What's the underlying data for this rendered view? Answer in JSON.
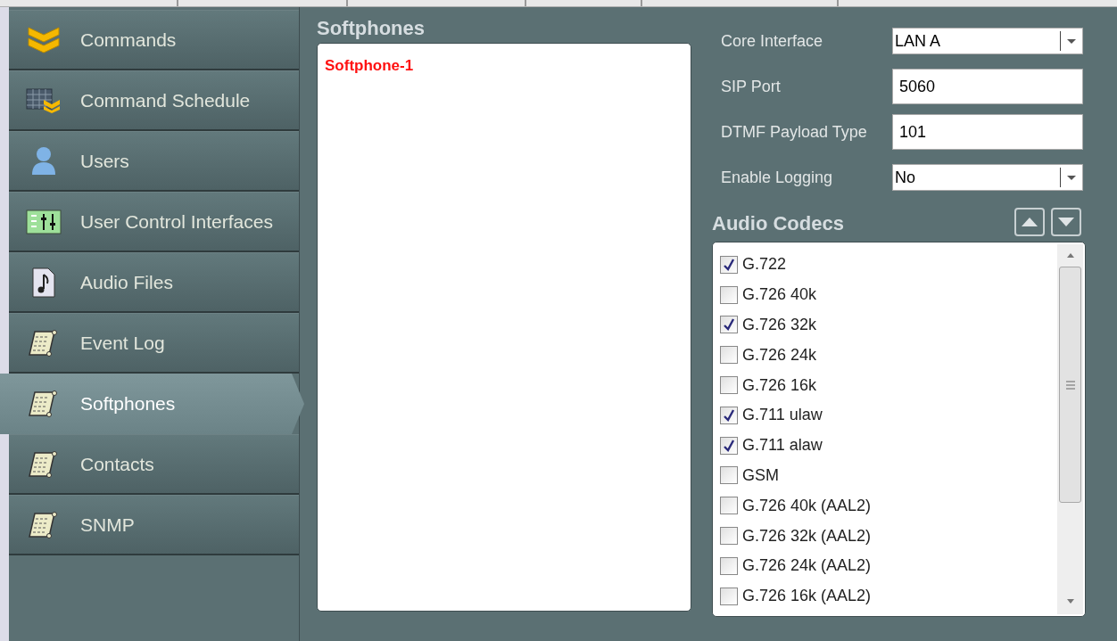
{
  "sidebar": {
    "items": [
      {
        "label": "Commands",
        "kind": "chevrons",
        "selected": false
      },
      {
        "label": "Command Schedule",
        "kind": "schedule",
        "selected": false
      },
      {
        "label": "Users",
        "kind": "user",
        "selected": false
      },
      {
        "label": "User Control Interfaces",
        "kind": "controls",
        "selected": false
      },
      {
        "label": "Audio Files",
        "kind": "audio",
        "selected": false
      },
      {
        "label": "Event Log",
        "kind": "scroll",
        "selected": false
      },
      {
        "label": "Softphones",
        "kind": "scroll",
        "selected": true
      },
      {
        "label": "Contacts",
        "kind": "scroll",
        "selected": false
      },
      {
        "label": "SNMP",
        "kind": "scroll",
        "selected": false
      }
    ]
  },
  "softphones": {
    "title": "Softphones",
    "items": [
      "Softphone-1"
    ]
  },
  "settings": [
    {
      "label": "Core Interface",
      "kind": "dropdown",
      "value": "LAN A"
    },
    {
      "label": "SIP Port",
      "kind": "text",
      "value": "5060"
    },
    {
      "label": "DTMF Payload Type",
      "kind": "text",
      "value": "101"
    },
    {
      "label": "Enable Logging",
      "kind": "dropdown",
      "value": "No"
    }
  ],
  "audio_codecs": {
    "title": "Audio Codecs",
    "items": [
      {
        "label": "G.722",
        "checked": true
      },
      {
        "label": "G.726 40k",
        "checked": false
      },
      {
        "label": "G.726 32k",
        "checked": true
      },
      {
        "label": "G.726 24k",
        "checked": false
      },
      {
        "label": "G.726 16k",
        "checked": false
      },
      {
        "label": "G.711 ulaw",
        "checked": true
      },
      {
        "label": "G.711 alaw",
        "checked": true
      },
      {
        "label": "GSM",
        "checked": false
      },
      {
        "label": "G.726 40k (AAL2)",
        "checked": false
      },
      {
        "label": "G.726 32k (AAL2)",
        "checked": false
      },
      {
        "label": "G.726 24k (AAL2)",
        "checked": false
      },
      {
        "label": "G.726 16k (AAL2)",
        "checked": false
      }
    ]
  }
}
